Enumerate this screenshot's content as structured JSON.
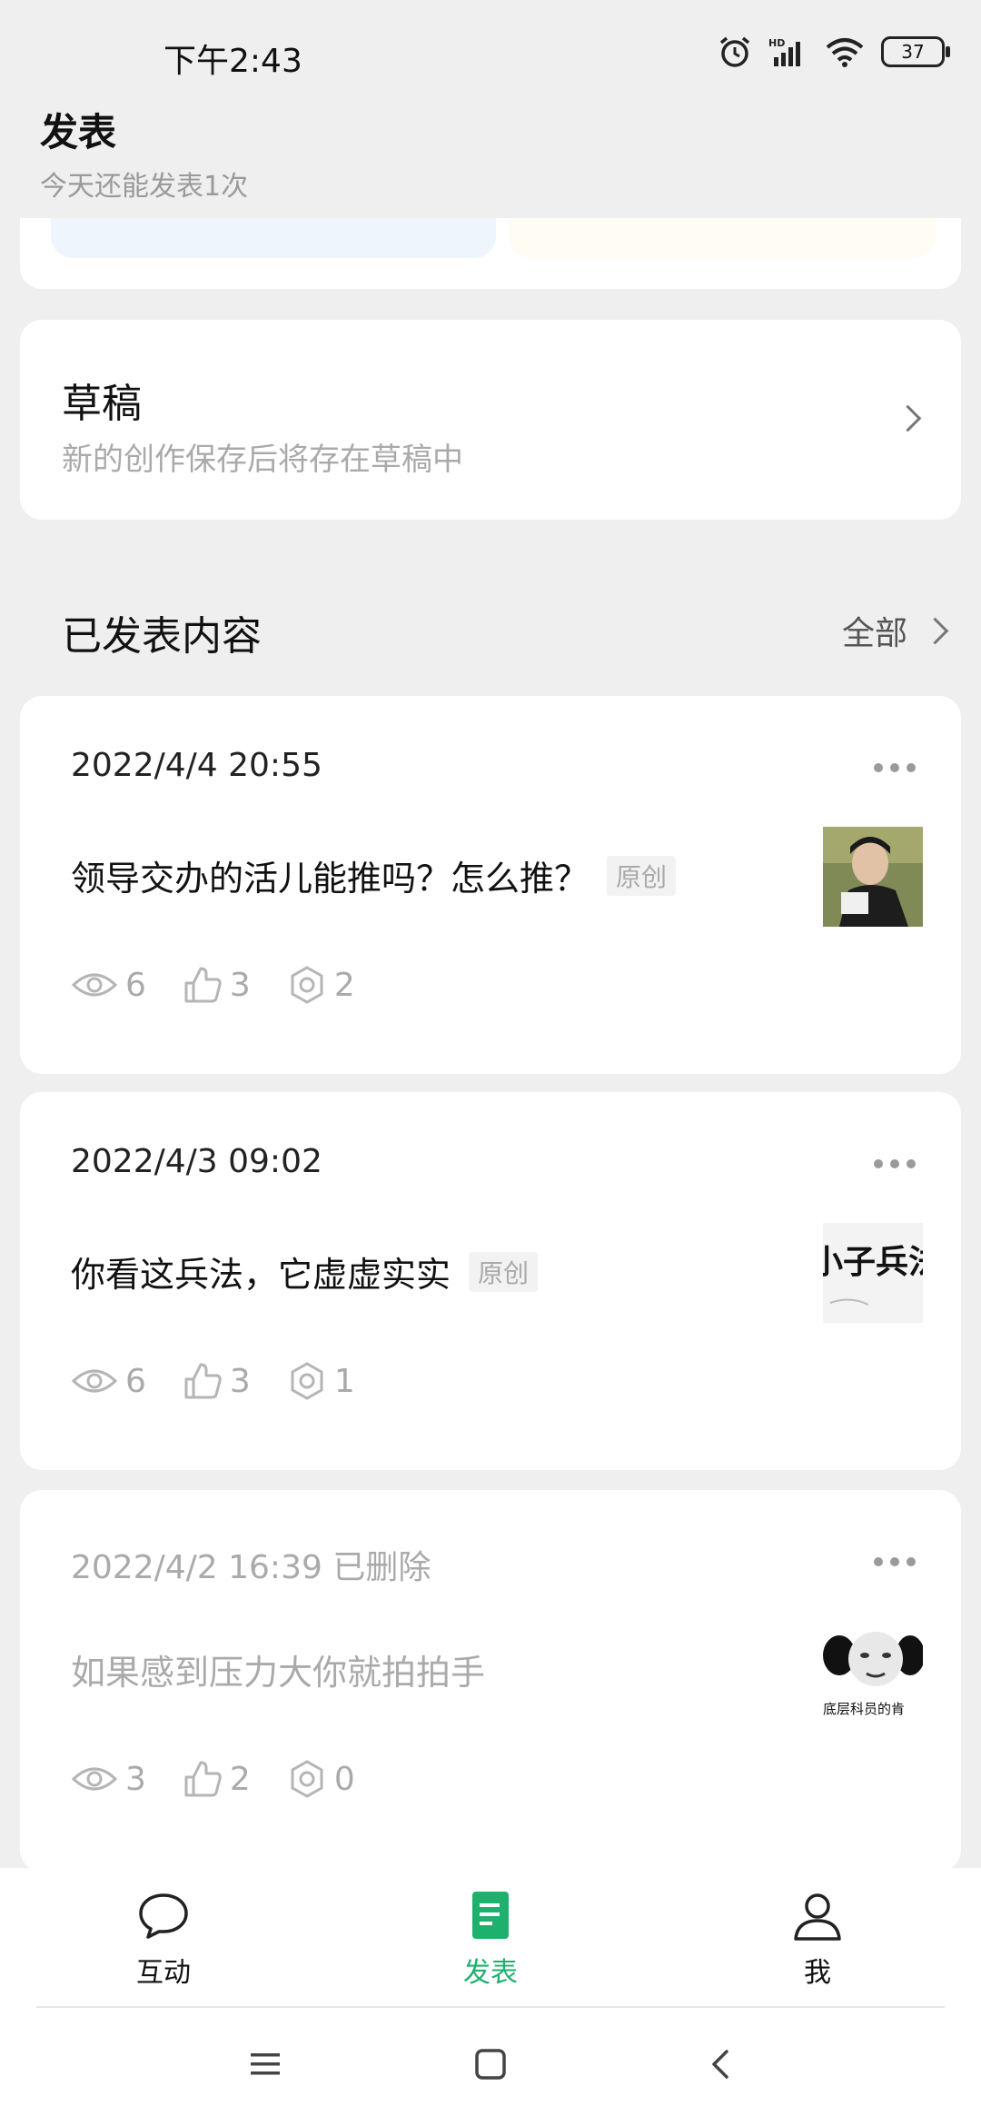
{
  "status": {
    "time": "下午2:43",
    "battery": "37",
    "network": "HD"
  },
  "header": {
    "title": "发表",
    "subtitle": "今天还能发表1次"
  },
  "draft": {
    "title": "草稿",
    "description": "新的创作保存后将存在草稿中"
  },
  "published": {
    "title": "已发表内容",
    "view_all": "全部"
  },
  "posts": [
    {
      "date": "2022/4/4 20:55",
      "title": "领导交办的活儿能推吗？怎么推？",
      "tag": "原创",
      "views": "6",
      "likes": "3",
      "shares": "2"
    },
    {
      "date": "2022/4/3 09:02",
      "title": "你看这兵法，它虚虚实实",
      "tag": "原创",
      "views": "6",
      "likes": "3",
      "shares": "1",
      "thumb_text": "小子兵法"
    },
    {
      "date": "2022/4/2 16:39 已删除",
      "title": "如果感到压力大你就拍拍手",
      "views": "3",
      "likes": "2",
      "shares": "0",
      "thumb_caption": "底层科员的肯"
    }
  ],
  "nav": {
    "items": [
      {
        "label": "互动"
      },
      {
        "label": "发表"
      },
      {
        "label": "我"
      }
    ]
  },
  "colors": {
    "accent": "#1eb16e",
    "background": "#efefef"
  }
}
